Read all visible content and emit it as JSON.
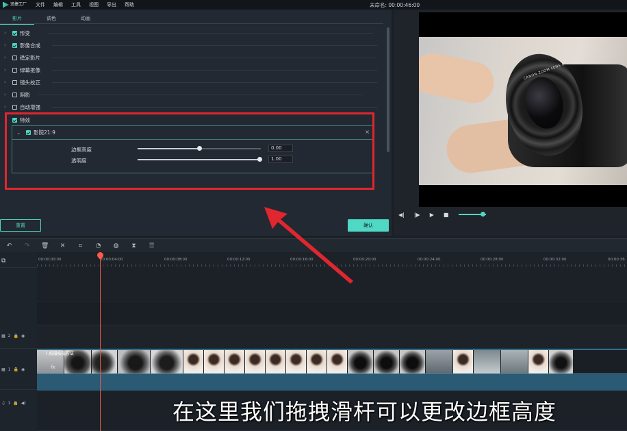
{
  "menubar": {
    "logo_text": "迅捷工厂",
    "items": [
      "文件",
      "编辑",
      "工具",
      "视图",
      "导出",
      "帮助"
    ],
    "project_title": "未命名: 00:00:46:00"
  },
  "panel": {
    "tabs": [
      "影片",
      "调色",
      "动画"
    ],
    "properties": [
      {
        "label": "形变",
        "checked": true
      },
      {
        "label": "影像合成",
        "checked": true
      },
      {
        "label": "稳定影片",
        "checked": false
      },
      {
        "label": "绿幕抠像",
        "checked": false
      },
      {
        "label": "镜头校正",
        "checked": false
      },
      {
        "label": "阴影",
        "checked": false
      },
      {
        "label": "自动增强",
        "checked": false
      },
      {
        "label": "特效",
        "checked": true
      }
    ],
    "effect": {
      "name": "影院21:9",
      "close": "×",
      "params": [
        {
          "label": "边框高度",
          "value": "0.00",
          "level": 0.5
        },
        {
          "label": "透明度",
          "value": "1.00",
          "level": 1.0
        }
      ]
    },
    "reset_label": "重置",
    "ok_label": "确认"
  },
  "preview": {
    "lens_text": "CANON ZOOM LENS EF-S 18-200mm",
    "progress": 0.2
  },
  "timeline": {
    "timecodes": [
      "00:00:00:00",
      "00:00:04:00",
      "00:00:08:00",
      "00:00:12:00",
      "00:00:16:00",
      "00:00:20:00",
      "00:00:24:00",
      "00:00:28:00",
      "00:00:32:00",
      "00:00:36"
    ],
    "tracks": [
      {
        "label": "2"
      },
      {
        "label": "1"
      },
      {
        "label": "1"
      }
    ],
    "clip_title": "7.拍摄拍摄方法"
  },
  "subtitle": "在这里我们拖拽滑杆可以更改边框高度",
  "colors": {
    "accent": "#4fd8c4",
    "highlight": "#e0262e"
  }
}
